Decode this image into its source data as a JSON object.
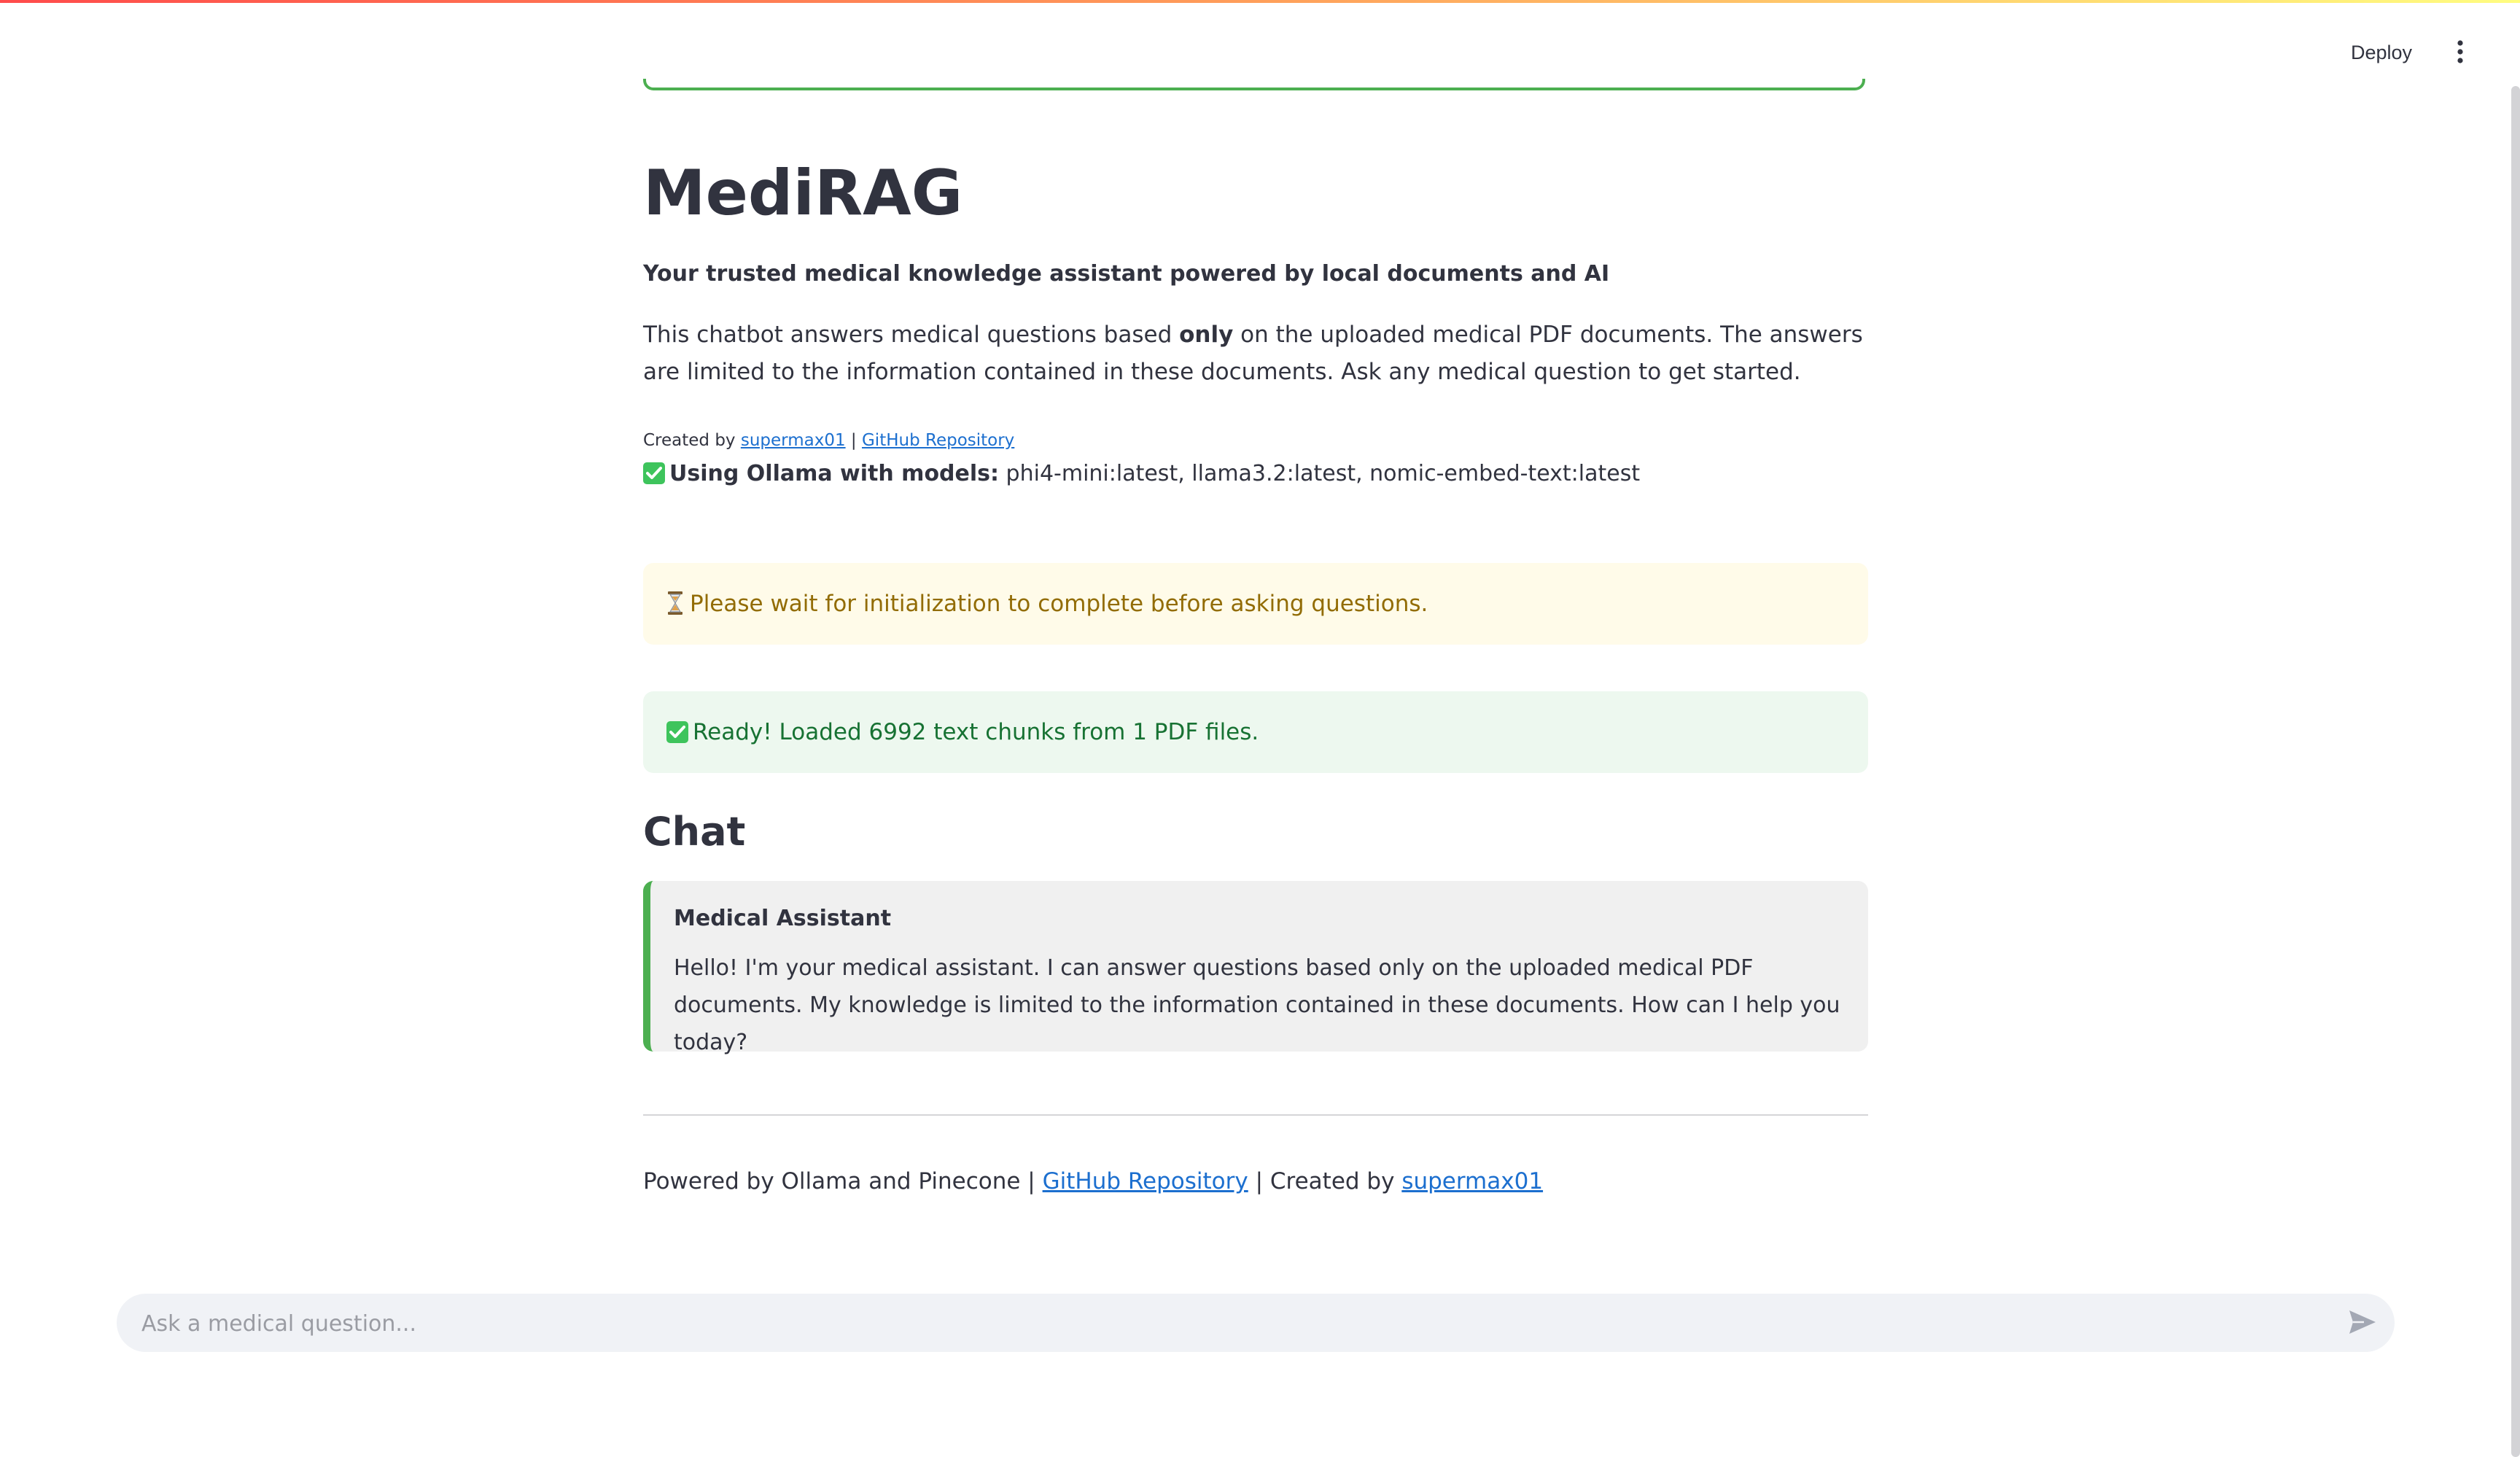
{
  "header": {
    "deploy_label": "Deploy",
    "menu_icon": "vertical-ellipsis-icon"
  },
  "main": {
    "title": "MediRAG",
    "subtitle": "Your trusted medical knowledge assistant powered by local documents and AI",
    "description": {
      "before": "This chatbot answers medical questions based ",
      "emphasis": "only",
      "after": " on the uploaded medical PDF documents. The answers are limited to the information contained in these documents. Ask any medical question to get started."
    },
    "credits": {
      "prefix": "Created by ",
      "author_link": "supermax01",
      "separator": " | ",
      "repo_link": "GitHub Repository"
    },
    "models": {
      "icon": "check-mark-icon",
      "label": "Using Ollama with models:",
      "value": " phi4-mini:latest, llama3.2:latest, nomic-embed-text:latest"
    }
  },
  "alerts": {
    "warning": {
      "icon": "hourglass-icon",
      "text": "Please wait for initialization to complete before asking questions."
    },
    "success": {
      "icon": "check-mark-icon",
      "text": "Ready! Loaded 6992 text chunks from 1 PDF files."
    }
  },
  "chat": {
    "heading": "Chat",
    "messages": [
      {
        "author": "Medical Assistant",
        "text": "Hello! I'm your medical assistant. I can answer questions based only on the uploaded medical PDF documents. My knowledge is limited to the information contained in these documents. How can I help you today?"
      }
    ]
  },
  "footer": {
    "prefix": "Powered by Ollama and Pinecone | ",
    "repo_link": "GitHub Repository",
    "middle": " | Created by ",
    "author_link": "supermax01"
  },
  "input": {
    "placeholder": "Ask a medical question...",
    "value": "",
    "send_icon": "send-icon"
  },
  "colors": {
    "accent_green": "#4caf50",
    "warning_bg": "#fffbe9",
    "warning_text": "#926c05",
    "success_bg": "#edf8ef",
    "success_text": "#177233",
    "link": "#1c6fcf"
  }
}
